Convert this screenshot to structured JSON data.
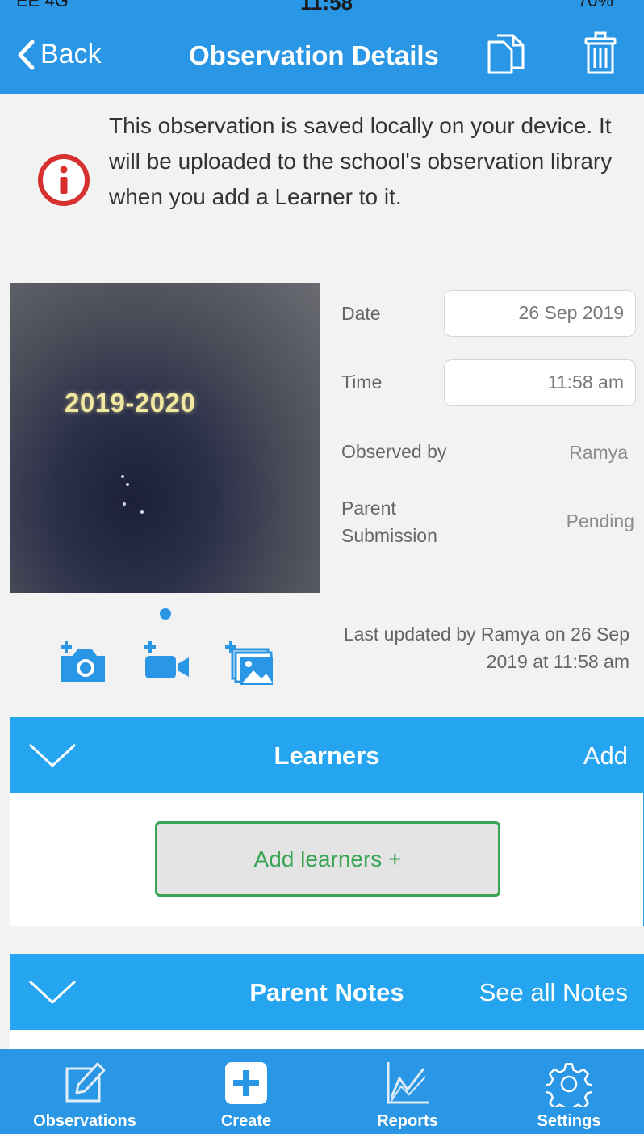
{
  "status_bar": {
    "carrier": "EE 4G",
    "time": "11:58",
    "battery": "70%"
  },
  "nav": {
    "back_label": "Back",
    "title": "Observation Details"
  },
  "notice": {
    "text": "This observation is saved locally on your device. It will be uploaded to the school's observation library when you add a Learner to it."
  },
  "photo": {
    "overlay_text": "2019-2020"
  },
  "details": {
    "date_label": "Date",
    "date_value": "26 Sep 2019",
    "time_label": "Time",
    "time_value": "11:58 am",
    "observed_by_label": "Observed by",
    "observed_by_value": "Ramya",
    "parent_submission_label_1": "Parent",
    "parent_submission_label_2": "Submission",
    "parent_submission_value": "Pending",
    "last_updated": "Last updated by Ramya on 26 Sep 2019 at 11:58 am"
  },
  "learners": {
    "title": "Learners",
    "action": "Add",
    "add_button": "Add learners +"
  },
  "parent_notes": {
    "title": "Parent Notes",
    "action": "See all Notes"
  },
  "tabs": [
    {
      "label": "Observations",
      "icon": "edit-icon"
    },
    {
      "label": "Create",
      "icon": "plus-icon"
    },
    {
      "label": "Reports",
      "icon": "chart-icon"
    },
    {
      "label": "Settings",
      "icon": "gear-icon"
    }
  ],
  "colors": {
    "primary": "#2a97e6",
    "section": "#25a4ef",
    "alert": "#d6312f",
    "success": "#3aa653"
  }
}
